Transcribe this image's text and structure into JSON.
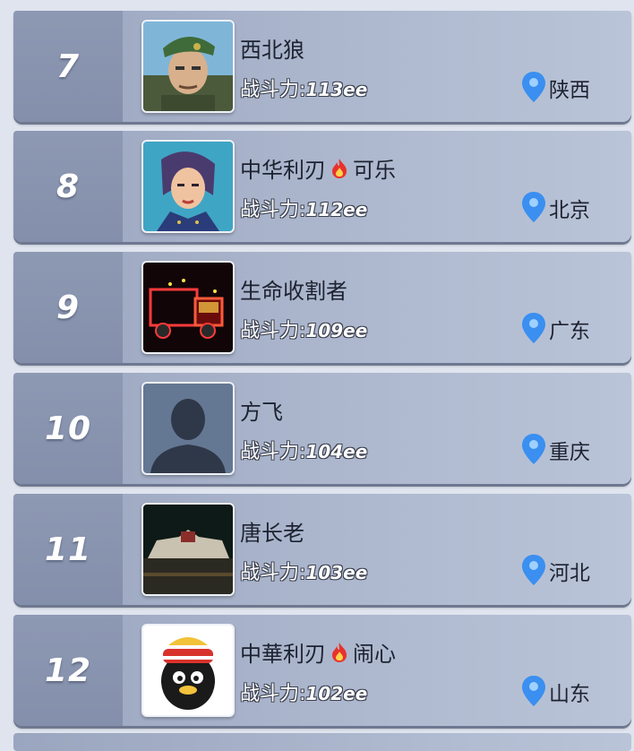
{
  "leaderboard": {
    "rows": [
      {
        "rank": "7",
        "name": "西北狼",
        "name_suffix": "",
        "has_flame": false,
        "power_label": "战斗力:",
        "power_value": "113ee",
        "location": "陕西",
        "avatar": "soldier-avatar"
      },
      {
        "rank": "8",
        "name": "中华利刃",
        "name_suffix": "可乐",
        "has_flame": true,
        "power_label": "战斗力:",
        "power_value": "112ee",
        "location": "北京",
        "avatar": "female-officer-avatar"
      },
      {
        "rank": "9",
        "name": "生命收割者",
        "name_suffix": "",
        "has_flame": false,
        "power_label": "战斗力:",
        "power_value": "109ee",
        "location": "广东",
        "avatar": "neon-truck-avatar"
      },
      {
        "rank": "10",
        "name": "方飞",
        "name_suffix": "",
        "has_flame": false,
        "power_label": "战斗力:",
        "power_value": "104ee",
        "location": "重庆",
        "avatar": "default-silhouette-avatar"
      },
      {
        "rank": "11",
        "name": "唐长老",
        "name_suffix": "",
        "has_flame": false,
        "power_label": "战斗力:",
        "power_value": "103ee",
        "location": "河北",
        "avatar": "night-palace-avatar"
      },
      {
        "rank": "12",
        "name": "中華利刃",
        "name_suffix": "闹心",
        "has_flame": true,
        "power_label": "战斗力:",
        "power_value": "102ee",
        "location": "山东",
        "avatar": "penguin-avatar"
      }
    ]
  },
  "icons": {
    "location": "location-pin-icon",
    "flame": "flame-icon"
  },
  "colors": {
    "pin": "#3a8ff0",
    "flame": "#e8322c",
    "row_bg": "#aab5cc",
    "rank_bg": "#8a95b0"
  }
}
